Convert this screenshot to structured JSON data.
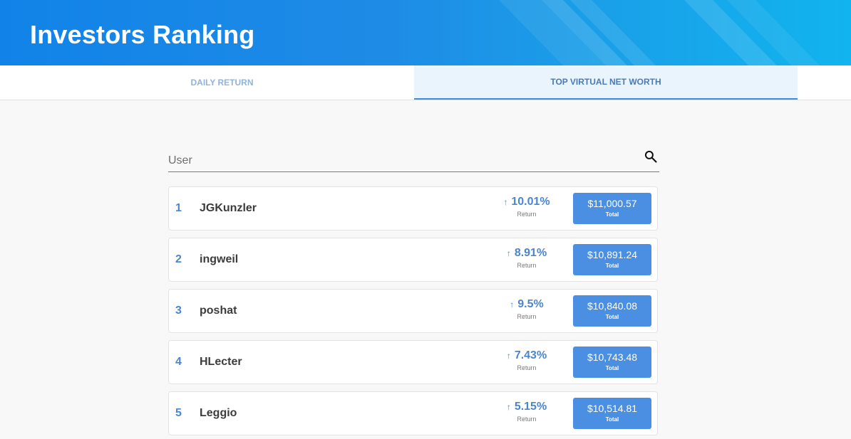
{
  "header": {
    "title": "Investors Ranking"
  },
  "tabs": [
    {
      "label": "DAILY RETURN",
      "active": false
    },
    {
      "label": "TOP VIRTUAL NET WORTH",
      "active": true
    }
  ],
  "search": {
    "placeholder": "User",
    "value": "",
    "icon": "search-icon"
  },
  "colors": {
    "header": "#1e8be6",
    "accent": "#4b8fe2",
    "rank": "#4a86cf"
  },
  "ranking": [
    {
      "rank": "1",
      "user": "JGKunzler",
      "return": "10.01%",
      "return_label": "Return",
      "total": "$11,000.57",
      "total_label": "Total"
    },
    {
      "rank": "2",
      "user": "ingweil",
      "return": "8.91%",
      "return_label": "Return",
      "total": "$10,891.24",
      "total_label": "Total"
    },
    {
      "rank": "3",
      "user": "poshat",
      "return": "9.5%",
      "return_label": "Return",
      "total": "$10,840.08",
      "total_label": "Total"
    },
    {
      "rank": "4",
      "user": "HLecter",
      "return": "7.43%",
      "return_label": "Return",
      "total": "$10,743.48",
      "total_label": "Total"
    },
    {
      "rank": "5",
      "user": "Leggio",
      "return": "5.15%",
      "return_label": "Return",
      "total": "$10,514.81",
      "total_label": "Total"
    }
  ]
}
